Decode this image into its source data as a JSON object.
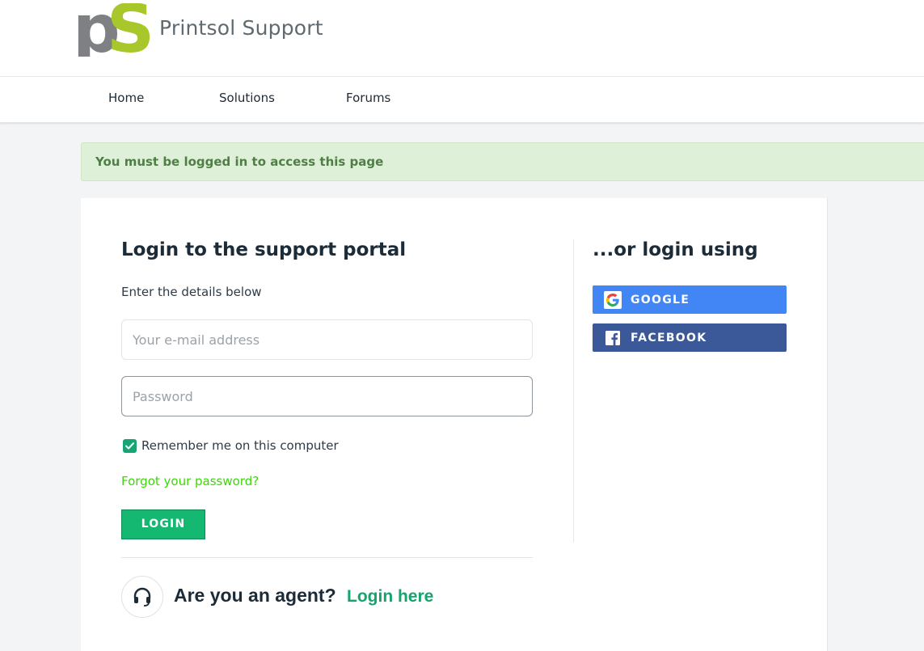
{
  "brand": {
    "logo_letters": "pS",
    "name": "Printsol Support",
    "colors": {
      "p": "#7e8084",
      "s": "#a7c72a"
    }
  },
  "nav": {
    "items": [
      {
        "label": "Home"
      },
      {
        "label": "Solutions"
      },
      {
        "label": "Forums"
      }
    ]
  },
  "alert": {
    "message": "You must be logged in to access this page",
    "color": "#dff0d8"
  },
  "login": {
    "title": "Login to the support portal",
    "subtitle": "Enter the details below",
    "email": {
      "placeholder": "Your e-mail address",
      "value": ""
    },
    "password": {
      "placeholder": "Password",
      "value": ""
    },
    "remember": {
      "label": "Remember me on this computer",
      "checked": true
    },
    "forgot_label": "Forgot your password?",
    "submit_label": "LOGIN"
  },
  "agent": {
    "question": "Are you an agent?",
    "link_label": "Login here",
    "icon": "headset-icon"
  },
  "social": {
    "title": "...or login using",
    "buttons": [
      {
        "label": "GOOGLE",
        "icon": "google-icon",
        "color": "#4285f4"
      },
      {
        "label": "FACEBOOK",
        "icon": "facebook-icon",
        "color": "#3b5998"
      }
    ]
  },
  "colors": {
    "accent": "#14b870",
    "link": "#3ed60b",
    "background": "#f3f4f6"
  }
}
